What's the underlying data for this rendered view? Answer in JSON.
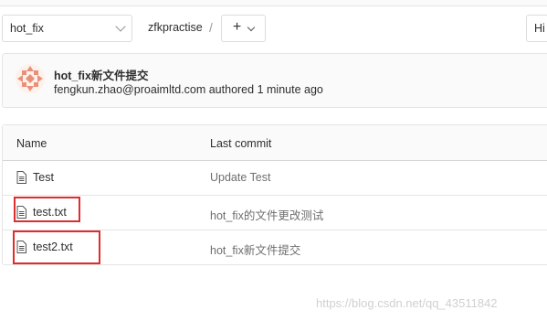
{
  "toolbar": {
    "branch": "hot_fix",
    "project": "zfkpractise",
    "separator": "/",
    "add_label": "+",
    "history_label": "Hi"
  },
  "commit": {
    "title": "hot_fix新文件提交",
    "author": "fengkun.zhao@proaimltd.com",
    "action": "authored",
    "time": "1 minute ago"
  },
  "table": {
    "headers": [
      "Name",
      "Last commit"
    ],
    "rows": [
      {
        "name": "Test",
        "last_commit": "Update Test",
        "highlighted": false
      },
      {
        "name": "test.txt",
        "last_commit": "hot_fix的文件更改测试",
        "highlighted": true
      },
      {
        "name": "test2.txt",
        "last_commit": "hot_fix新文件提交",
        "highlighted": true
      }
    ]
  },
  "watermark": "https://blog.csdn.net/qq_43511842",
  "colors": {
    "highlight": "#e02c2c",
    "avatar": "#e8917a"
  }
}
